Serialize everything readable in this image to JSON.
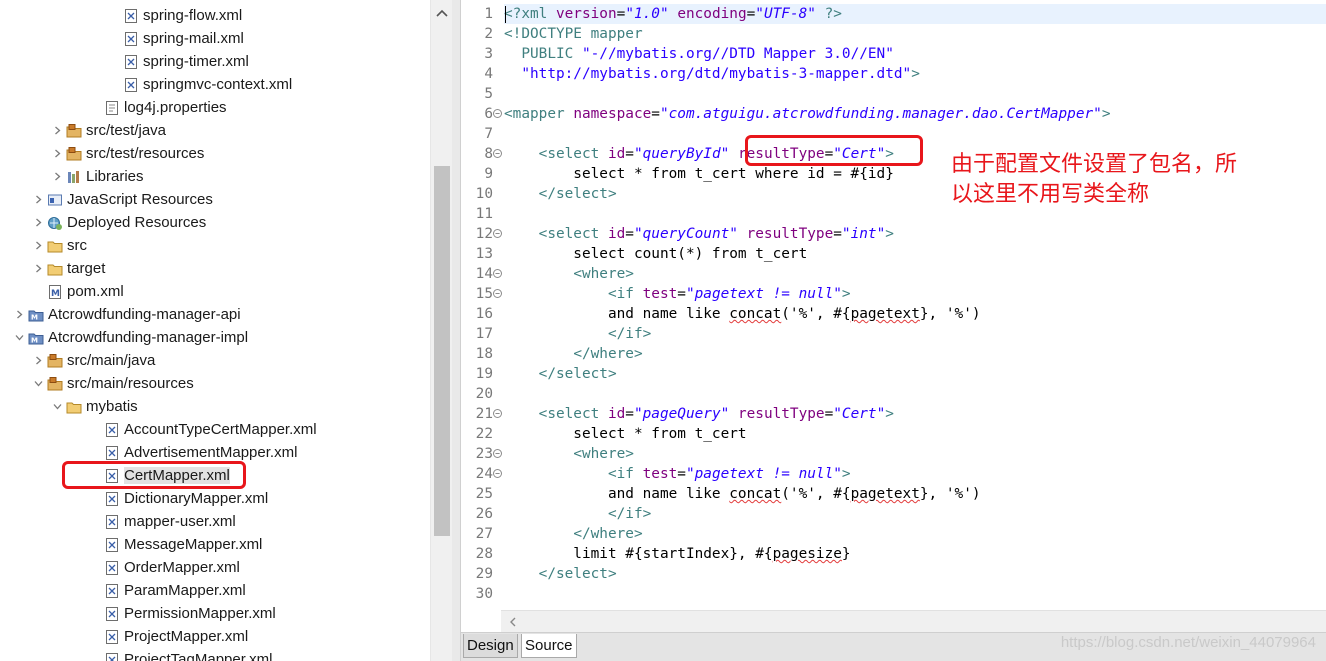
{
  "explorer": {
    "items": [
      {
        "label": "spring-flow.xml",
        "icon": "xml-file-icon",
        "depth": 5,
        "twisty": ""
      },
      {
        "label": "spring-mail.xml",
        "icon": "xml-file-icon",
        "depth": 5,
        "twisty": ""
      },
      {
        "label": "spring-timer.xml",
        "icon": "xml-file-icon",
        "depth": 5,
        "twisty": ""
      },
      {
        "label": "springmvc-context.xml",
        "icon": "xml-file-icon",
        "depth": 5,
        "twisty": ""
      },
      {
        "label": "log4j.properties",
        "icon": "properties-file-icon",
        "depth": 4,
        "twisty": ""
      },
      {
        "label": "src/test/java",
        "icon": "source-folder-icon",
        "depth": 2,
        "twisty": "collapsed"
      },
      {
        "label": "src/test/resources",
        "icon": "source-folder-icon",
        "depth": 2,
        "twisty": "collapsed"
      },
      {
        "label": "Libraries",
        "icon": "libraries-icon",
        "depth": 2,
        "twisty": "collapsed"
      },
      {
        "label": "JavaScript Resources",
        "icon": "javascript-resources-icon",
        "depth": 1,
        "twisty": "collapsed"
      },
      {
        "label": "Deployed Resources",
        "icon": "deployed-resources-icon",
        "depth": 1,
        "twisty": "collapsed"
      },
      {
        "label": "src",
        "icon": "folder-icon",
        "depth": 1,
        "twisty": "collapsed"
      },
      {
        "label": "target",
        "icon": "folder-icon",
        "depth": 1,
        "twisty": "collapsed"
      },
      {
        "label": "pom.xml",
        "icon": "maven-pom-icon",
        "depth": 1,
        "twisty": ""
      },
      {
        "label": "Atcrowdfunding-manager-api",
        "icon": "maven-project-icon",
        "depth": 0,
        "twisty": "collapsed"
      },
      {
        "label": "Atcrowdfunding-manager-impl",
        "icon": "maven-project-icon",
        "depth": 0,
        "twisty": "expanded"
      },
      {
        "label": "src/main/java",
        "icon": "source-folder-icon",
        "depth": 1,
        "twisty": "collapsed"
      },
      {
        "label": "src/main/resources",
        "icon": "source-folder-icon",
        "depth": 1,
        "twisty": "expanded"
      },
      {
        "label": "mybatis",
        "icon": "folder-icon",
        "depth": 2,
        "twisty": "expanded"
      },
      {
        "label": "AccountTypeCertMapper.xml",
        "icon": "xml-file-icon",
        "depth": 4,
        "twisty": ""
      },
      {
        "label": "AdvertisementMapper.xml",
        "icon": "xml-file-icon",
        "depth": 4,
        "twisty": ""
      },
      {
        "label": "CertMapper.xml",
        "icon": "xml-file-icon",
        "depth": 4,
        "twisty": "",
        "selected": true
      },
      {
        "label": "DictionaryMapper.xml",
        "icon": "xml-file-icon",
        "depth": 4,
        "twisty": ""
      },
      {
        "label": "mapper-user.xml",
        "icon": "xml-file-icon",
        "depth": 4,
        "twisty": ""
      },
      {
        "label": "MessageMapper.xml",
        "icon": "xml-file-icon",
        "depth": 4,
        "twisty": ""
      },
      {
        "label": "OrderMapper.xml",
        "icon": "xml-file-icon",
        "depth": 4,
        "twisty": ""
      },
      {
        "label": "ParamMapper.xml",
        "icon": "xml-file-icon",
        "depth": 4,
        "twisty": ""
      },
      {
        "label": "PermissionMapper.xml",
        "icon": "xml-file-icon",
        "depth": 4,
        "twisty": ""
      },
      {
        "label": "ProjectMapper.xml",
        "icon": "xml-file-icon",
        "depth": 4,
        "twisty": ""
      },
      {
        "label": "ProjectTagMapper.xml",
        "icon": "xml-file-icon",
        "depth": 4,
        "twisty": ""
      }
    ]
  },
  "editor": {
    "lines": [
      {
        "n": "1",
        "fold": false,
        "tokens": [
          [
            "c-tag",
            "<?xml "
          ],
          [
            "c-attr",
            "version"
          ],
          [
            "c-text",
            "="
          ],
          [
            "c-val",
            "\"1.0\""
          ],
          [
            "c-text",
            " "
          ],
          [
            "c-attr",
            "encoding"
          ],
          [
            "c-text",
            "="
          ],
          [
            "c-val",
            "\"UTF-8\""
          ],
          [
            "c-tag",
            " ?>"
          ]
        ]
      },
      {
        "n": "2",
        "fold": false,
        "tokens": [
          [
            "c-dt",
            "<!DOCTYPE mapper"
          ]
        ]
      },
      {
        "n": "3",
        "fold": false,
        "tokens": [
          [
            "c-dt",
            "  PUBLIC "
          ],
          [
            "c-str",
            "\"-//mybatis.org//DTD Mapper 3.0//EN\""
          ]
        ]
      },
      {
        "n": "4",
        "fold": false,
        "tokens": [
          [
            "c-str",
            "  \"http://mybatis.org/dtd/mybatis-3-mapper.dtd\""
          ],
          [
            "c-dt",
            ">"
          ]
        ]
      },
      {
        "n": "5",
        "fold": false,
        "tokens": []
      },
      {
        "n": "6",
        "fold": true,
        "tokens": [
          [
            "c-tag",
            "<mapper "
          ],
          [
            "c-attr",
            "namespace"
          ],
          [
            "c-text",
            "="
          ],
          [
            "c-val",
            "\"com.atguigu.atcrowdfunding.manager.dao.CertMapper\""
          ],
          [
            "c-tag",
            ">"
          ]
        ]
      },
      {
        "n": "7",
        "fold": false,
        "tokens": []
      },
      {
        "n": "8",
        "fold": true,
        "tokens": [
          [
            "c-text",
            "    "
          ],
          [
            "c-tag",
            "<select "
          ],
          [
            "c-attr",
            "id"
          ],
          [
            "c-text",
            "="
          ],
          [
            "c-val",
            "\"queryById\""
          ],
          [
            "c-text",
            " "
          ],
          [
            "c-attr",
            "resultType"
          ],
          [
            "c-text",
            "="
          ],
          [
            "c-val",
            "\"Cert\""
          ],
          [
            "c-tag",
            ">"
          ]
        ]
      },
      {
        "n": "9",
        "fold": false,
        "tokens": [
          [
            "c-text",
            "        select * from t_cert where id = #{id}"
          ]
        ]
      },
      {
        "n": "10",
        "fold": false,
        "tokens": [
          [
            "c-text",
            "    "
          ],
          [
            "c-tag",
            "</select>"
          ]
        ]
      },
      {
        "n": "11",
        "fold": false,
        "tokens": []
      },
      {
        "n": "12",
        "fold": true,
        "tokens": [
          [
            "c-text",
            "    "
          ],
          [
            "c-tag",
            "<select "
          ],
          [
            "c-attr",
            "id"
          ],
          [
            "c-text",
            "="
          ],
          [
            "c-val",
            "\"queryCount\""
          ],
          [
            "c-text",
            " "
          ],
          [
            "c-attr",
            "resultType"
          ],
          [
            "c-text",
            "="
          ],
          [
            "c-val",
            "\"int\""
          ],
          [
            "c-tag",
            ">"
          ]
        ]
      },
      {
        "n": "13",
        "fold": false,
        "tokens": [
          [
            "c-text",
            "        select count(*) from t_cert"
          ]
        ]
      },
      {
        "n": "14",
        "fold": true,
        "tokens": [
          [
            "c-text",
            "        "
          ],
          [
            "c-tag",
            "<where>"
          ]
        ]
      },
      {
        "n": "15",
        "fold": true,
        "tokens": [
          [
            "c-text",
            "            "
          ],
          [
            "c-tag",
            "<if "
          ],
          [
            "c-attr",
            "test"
          ],
          [
            "c-text",
            "="
          ],
          [
            "c-val",
            "\"pagetext != null\""
          ],
          [
            "c-tag",
            ">"
          ]
        ]
      },
      {
        "n": "16",
        "fold": false,
        "tokens": [
          [
            "c-text",
            "            and name like "
          ],
          [
            "squig",
            "concat"
          ],
          [
            "c-text",
            "('%', #{"
          ],
          [
            "squig",
            "pagetext"
          ],
          [
            "c-text",
            "}, '%')"
          ]
        ]
      },
      {
        "n": "17",
        "fold": false,
        "tokens": [
          [
            "c-text",
            "            "
          ],
          [
            "c-tag",
            "</if>"
          ]
        ]
      },
      {
        "n": "18",
        "fold": false,
        "tokens": [
          [
            "c-text",
            "        "
          ],
          [
            "c-tag",
            "</where>"
          ]
        ]
      },
      {
        "n": "19",
        "fold": false,
        "tokens": [
          [
            "c-text",
            "    "
          ],
          [
            "c-tag",
            "</select>"
          ]
        ]
      },
      {
        "n": "20",
        "fold": false,
        "tokens": []
      },
      {
        "n": "21",
        "fold": true,
        "tokens": [
          [
            "c-text",
            "    "
          ],
          [
            "c-tag",
            "<select "
          ],
          [
            "c-attr",
            "id"
          ],
          [
            "c-text",
            "="
          ],
          [
            "c-val",
            "\"pageQuery\""
          ],
          [
            "c-text",
            " "
          ],
          [
            "c-attr",
            "resultType"
          ],
          [
            "c-text",
            "="
          ],
          [
            "c-val",
            "\"Cert\""
          ],
          [
            "c-tag",
            ">"
          ]
        ]
      },
      {
        "n": "22",
        "fold": false,
        "tokens": [
          [
            "c-text",
            "        select * from t_cert"
          ]
        ]
      },
      {
        "n": "23",
        "fold": true,
        "tokens": [
          [
            "c-text",
            "        "
          ],
          [
            "c-tag",
            "<where>"
          ]
        ]
      },
      {
        "n": "24",
        "fold": true,
        "tokens": [
          [
            "c-text",
            "            "
          ],
          [
            "c-tag",
            "<if "
          ],
          [
            "c-attr",
            "test"
          ],
          [
            "c-text",
            "="
          ],
          [
            "c-val",
            "\"pagetext != null\""
          ],
          [
            "c-tag",
            ">"
          ]
        ]
      },
      {
        "n": "25",
        "fold": false,
        "tokens": [
          [
            "c-text",
            "            and name like "
          ],
          [
            "squig",
            "concat"
          ],
          [
            "c-text",
            "('%', #{"
          ],
          [
            "squig",
            "pagetext"
          ],
          [
            "c-text",
            "}, '%')"
          ]
        ]
      },
      {
        "n": "26",
        "fold": false,
        "tokens": [
          [
            "c-text",
            "            "
          ],
          [
            "c-tag",
            "</if>"
          ]
        ]
      },
      {
        "n": "27",
        "fold": false,
        "tokens": [
          [
            "c-text",
            "        "
          ],
          [
            "c-tag",
            "</where>"
          ]
        ]
      },
      {
        "n": "28",
        "fold": false,
        "tokens": [
          [
            "c-text",
            "        limit #{startIndex}, #{"
          ],
          [
            "squig",
            "pagesize"
          ],
          [
            "c-text",
            "}"
          ]
        ]
      },
      {
        "n": "29",
        "fold": false,
        "tokens": [
          [
            "c-text",
            "    "
          ],
          [
            "c-tag",
            "</select>"
          ]
        ]
      },
      {
        "n": "30",
        "fold": false,
        "tokens": []
      }
    ],
    "annotation_line1": "由于配置文件设置了包名，所",
    "annotation_line2": "以这里不用写类全称",
    "tabs": [
      {
        "label": "Design",
        "active": false
      },
      {
        "label": "Source",
        "active": true
      }
    ]
  },
  "watermark": "https://blog.csdn.net/weixin_44079964",
  "colors": {
    "annotation_red": "#e8161b",
    "tag": "#3f7f7f",
    "attribute": "#7f007f",
    "value": "#2a00ff"
  }
}
